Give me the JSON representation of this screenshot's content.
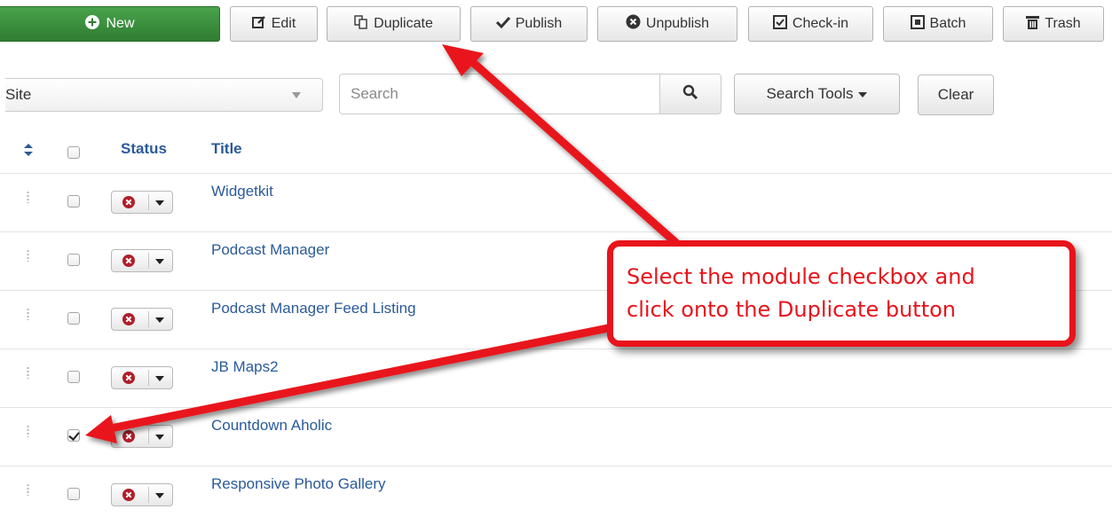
{
  "toolbar": {
    "new_label": "New",
    "edit_label": "Edit",
    "duplicate_label": "Duplicate",
    "publish_label": "Publish",
    "unpublish_label": "Unpublish",
    "checkin_label": "Check-in",
    "batch_label": "Batch",
    "trash_label": "Trash"
  },
  "filters": {
    "site_select_value": "Site",
    "search_placeholder": "Search",
    "search_tools_label": "Search Tools",
    "clear_label": "Clear"
  },
  "table": {
    "columns": {
      "status": "Status",
      "title": "Title"
    },
    "rows": [
      {
        "title": "Widgetkit",
        "checked": false
      },
      {
        "title": "Podcast Manager",
        "checked": false
      },
      {
        "title": "Podcast Manager Feed Listing",
        "checked": false
      },
      {
        "title": "JB Maps2",
        "checked": false
      },
      {
        "title": "Countdown Aholic",
        "checked": true
      },
      {
        "title": "Responsive Photo Gallery",
        "checked": false
      }
    ]
  },
  "annotation": {
    "line1": "Select the module checkbox and",
    "line2": "click onto the Duplicate button",
    "color": "#e8131b"
  },
  "colors": {
    "new_button": "#3a8f3d",
    "link": "#2a5a99",
    "unpublished_icon": "#b01e2a"
  },
  "icons": [
    "plus-circle-icon",
    "edit-icon",
    "duplicate-icon",
    "checkmark-icon",
    "x-circle-icon",
    "checkbox-icon",
    "batch-icon",
    "trash-icon",
    "search-icon",
    "sort-icon",
    "drag-handle-icon"
  ]
}
